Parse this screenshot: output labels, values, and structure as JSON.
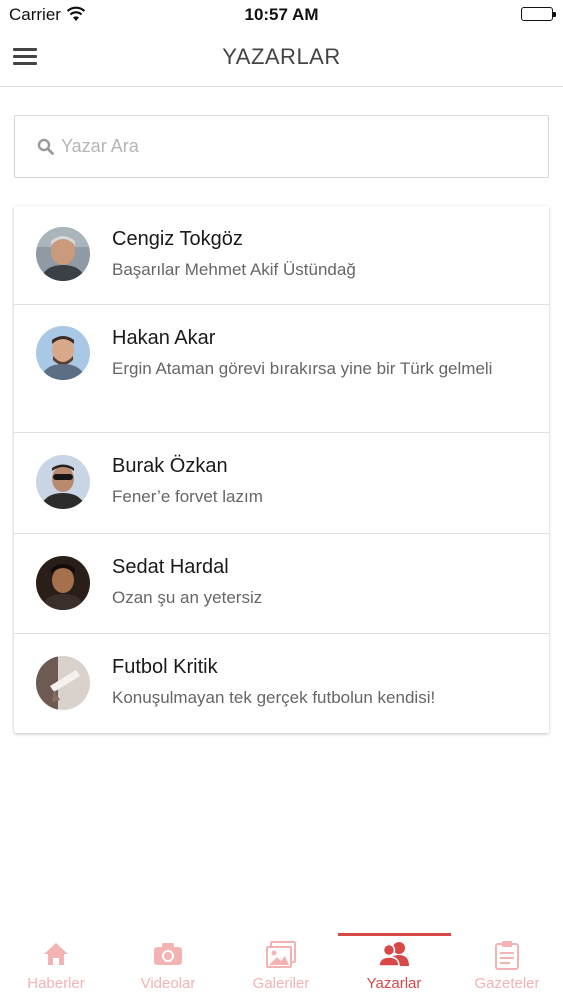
{
  "status": {
    "carrier": "Carrier",
    "time": "10:57 AM"
  },
  "nav": {
    "title": "YAZARLAR"
  },
  "search": {
    "placeholder": "Yazar Ara"
  },
  "authors": [
    {
      "name": "Cengiz Tokgöz",
      "headline": "Başarılar Mehmet Akif Üstündağ"
    },
    {
      "name": "Hakan Akar",
      "headline": "Ergin Ataman görevi bırakırsa yine bir Türk gelmeli"
    },
    {
      "name": "Burak Özkan",
      "headline": "Fener’e forvet lazım"
    },
    {
      "name": "Sedat Hardal",
      "headline": "Ozan şu an yetersiz"
    },
    {
      "name": "Futbol Kritik",
      "headline": "Konuşulmayan tek gerçek futbolun kendisi!"
    }
  ],
  "tabs": [
    {
      "label": "Haberler",
      "icon": "home-icon",
      "active": false
    },
    {
      "label": "Videolar",
      "icon": "camera-icon",
      "active": false
    },
    {
      "label": "Galeriler",
      "icon": "image-icon",
      "active": false
    },
    {
      "label": "Yazarlar",
      "icon": "users-icon",
      "active": true
    },
    {
      "label": "Gazeteler",
      "icon": "clipboard-icon",
      "active": false
    }
  ],
  "colors": {
    "accent": "#d94848",
    "inactive_tab": "#f3b3b3"
  }
}
